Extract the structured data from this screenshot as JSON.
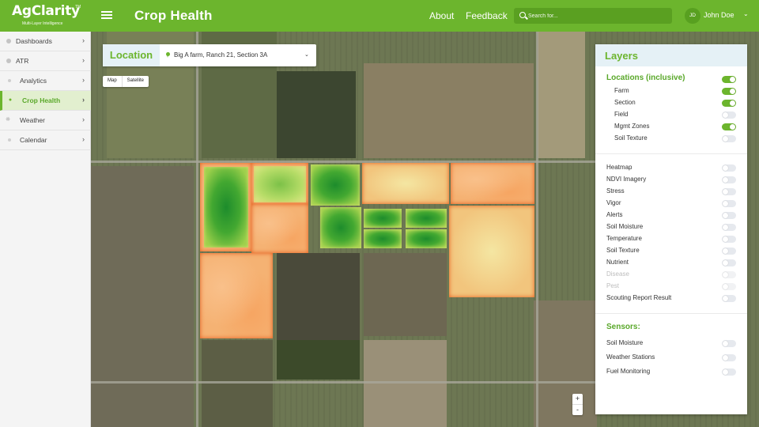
{
  "app": {
    "logo": "AgClarity",
    "logo_tm": "TM",
    "logo_tagline": "Multi-Layer Intelligence",
    "page_title": "Crop Health"
  },
  "header": {
    "about": "About",
    "feedback": "Feedback",
    "search_placeholder": "Search for...",
    "avatar_initials": "JD",
    "username": "John Doe"
  },
  "sidebar": {
    "items": [
      {
        "label": "Dashboards",
        "icon": "dashboard-icon"
      },
      {
        "label": "ATR",
        "icon": "atr-icon"
      },
      {
        "label": "Analytics",
        "icon": "analytics-icon"
      },
      {
        "label": "Crop Health",
        "icon": "crop-health-icon",
        "active": true
      },
      {
        "label": "Weather",
        "icon": "weather-icon"
      },
      {
        "label": "Calendar",
        "icon": "calendar-icon"
      }
    ]
  },
  "map": {
    "location_label": "Location",
    "location_value": "Big A farm, Ranch 21, Section 3A",
    "map_button": "Map",
    "satellite_button": "Satellite",
    "zoom_in": "+",
    "zoom_out": "-"
  },
  "layers": {
    "title": "Layers",
    "locations_heading": "Locations (inclusive)",
    "locations": [
      {
        "label": "Farm",
        "on": true
      },
      {
        "label": "Section",
        "on": true
      },
      {
        "label": "Field",
        "on": false
      },
      {
        "label": "Mgmt Zones",
        "on": true
      },
      {
        "label": "Soil Texture",
        "on": false
      }
    ],
    "overlays": [
      {
        "label": "Heatmap",
        "on": false
      },
      {
        "label": "NDVI Imagery",
        "on": false
      },
      {
        "label": "Stress",
        "on": false
      },
      {
        "label": "Vigor",
        "on": false
      },
      {
        "label": "Alerts",
        "on": false
      },
      {
        "label": "Soil Moisture",
        "on": false
      },
      {
        "label": "Temperature",
        "on": false
      },
      {
        "label": "Soil Texture",
        "on": false
      },
      {
        "label": "Nutrient",
        "on": false
      },
      {
        "label": "Disease",
        "on": false,
        "disabled": true
      },
      {
        "label": "Pest",
        "on": false,
        "disabled": true
      },
      {
        "label": "Scouting Report Result",
        "on": false
      }
    ],
    "sensors_heading": "Sensors:",
    "sensors": [
      {
        "label": "Soil Moisture",
        "on": false
      },
      {
        "label": "Weather Stations",
        "on": false
      },
      {
        "label": "Fuel Monitoring",
        "on": false
      }
    ]
  },
  "colors": {
    "brand_green": "#6cb52d",
    "heat_orange": "#f5b273",
    "heat_green": "#43a831"
  }
}
